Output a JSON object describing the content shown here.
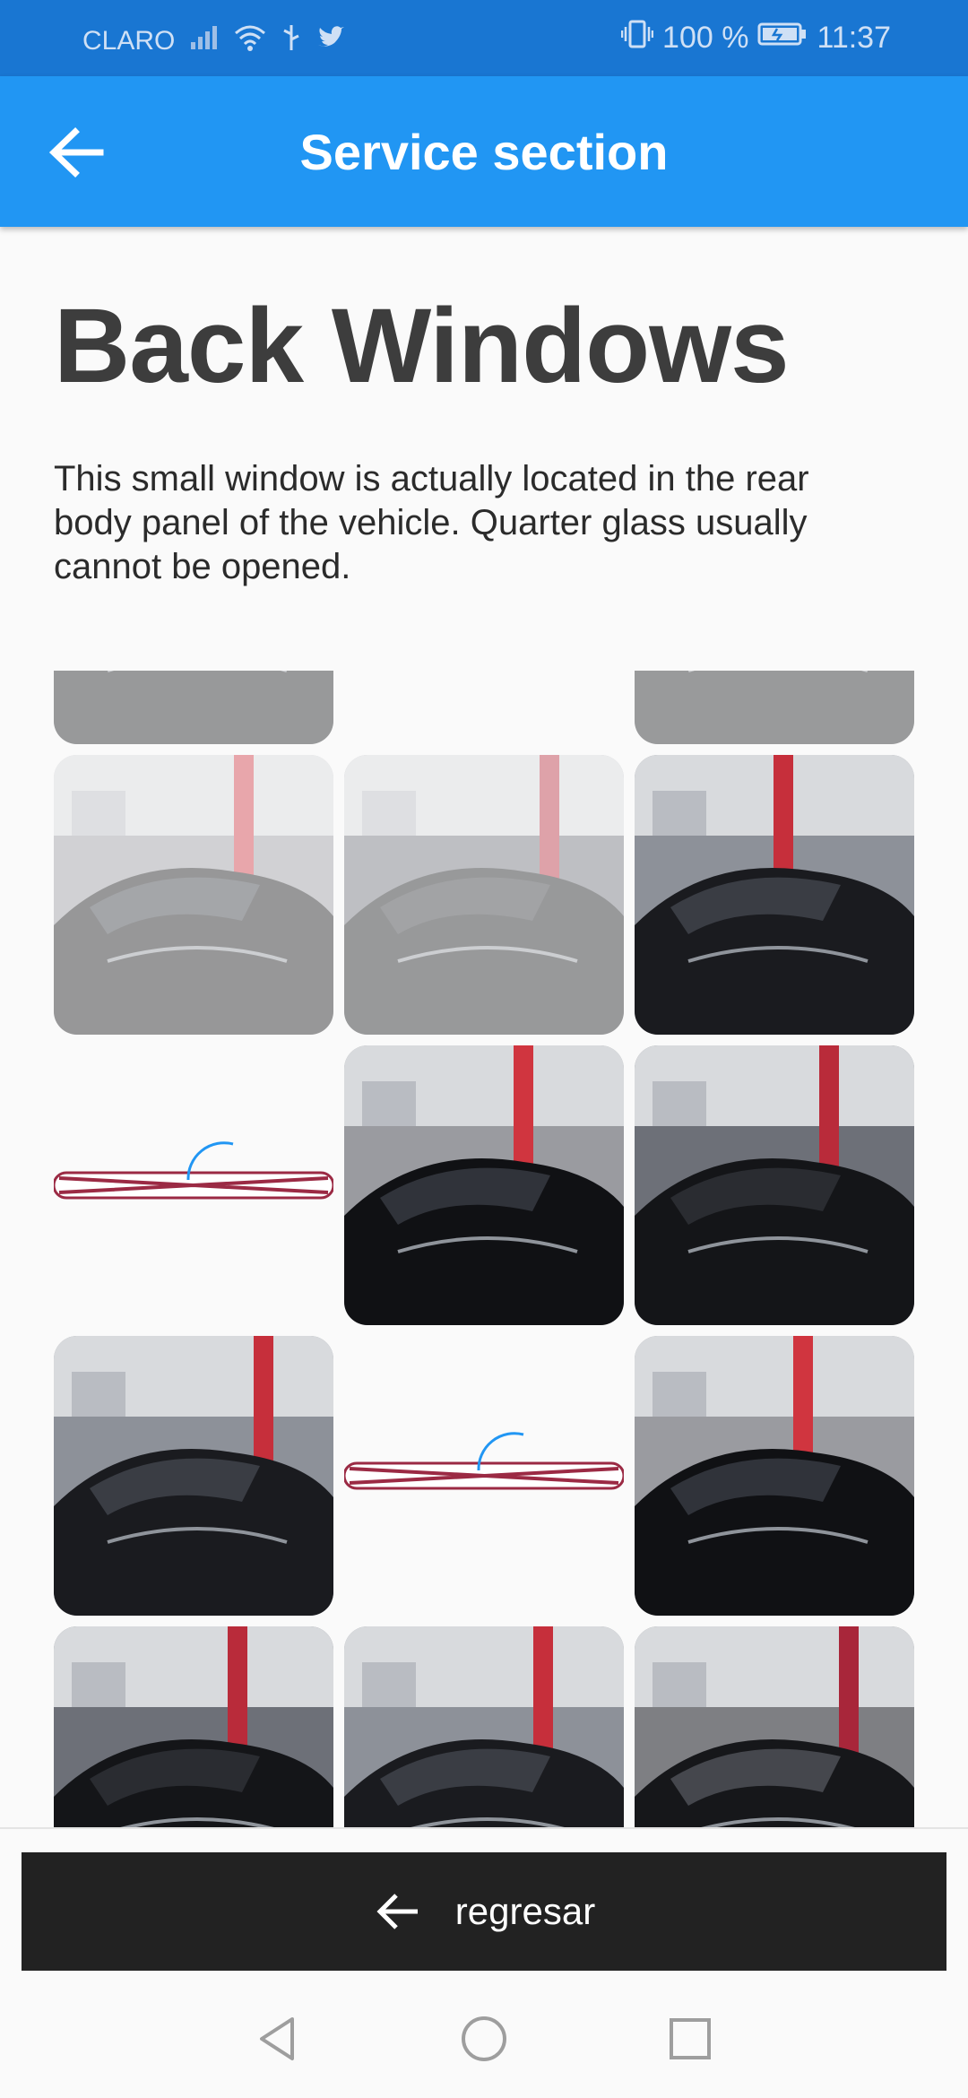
{
  "status_bar": {
    "carrier": "CLARO",
    "battery_percent": "100 %",
    "time": "11:37"
  },
  "app_bar": {
    "title": "Service section",
    "back_icon": "arrow-back-icon"
  },
  "content": {
    "title": "Back Windows",
    "description": "This small window is actually located in the rear body panel of the vehicle. Quarter glass usually cannot be opened."
  },
  "images": [
    {
      "state": "loaded-faded"
    },
    {
      "state": "empty"
    },
    {
      "state": "loaded-faded"
    },
    {
      "state": "loaded-faded"
    },
    {
      "state": "loaded-faded"
    },
    {
      "state": "loaded"
    },
    {
      "state": "loading"
    },
    {
      "state": "loaded"
    },
    {
      "state": "loaded"
    },
    {
      "state": "loaded"
    },
    {
      "state": "loading"
    },
    {
      "state": "loaded"
    },
    {
      "state": "loaded"
    },
    {
      "state": "loaded"
    },
    {
      "state": "loaded"
    }
  ],
  "bottom_button": {
    "label": "regresar",
    "icon": "arrow-back-icon"
  },
  "nav_bar": {
    "back": "nav-back-icon",
    "home": "nav-home-icon",
    "recents": "nav-recents-icon"
  },
  "colors": {
    "status_bar": "#1976d2",
    "app_bar": "#2196f3",
    "button": "#222222",
    "spinner": "#2196f3",
    "placeholder_x": "#9b2a44"
  }
}
